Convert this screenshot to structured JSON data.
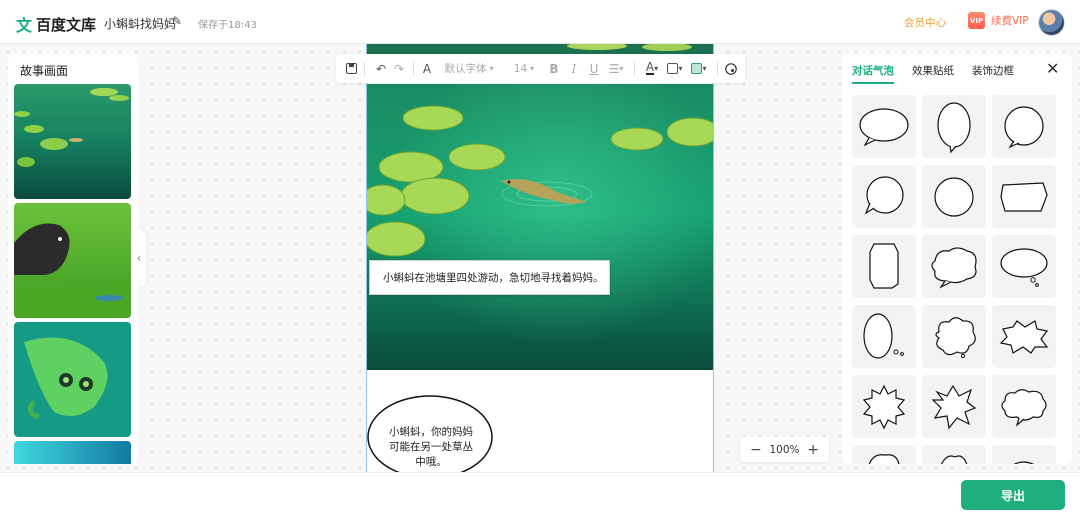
{
  "header": {
    "logo_glyph": "文",
    "logo_text": "百度文库",
    "doc_title": "小蝌蚪找妈妈",
    "save_status": "保存于18:43",
    "member_center": "会员中心",
    "vip_badge": "VIP",
    "vip_label": "续费VIP"
  },
  "left_panel": {
    "title": "故事画面",
    "collapse_glyph": "‹"
  },
  "toolbar": {
    "font_family": "默认字体",
    "font_size": "14",
    "bold": "B",
    "italic": "I",
    "underline": "U",
    "text_glyph": "A",
    "dropdown_glyph": "▾"
  },
  "canvas": {
    "caption": "小蝌蚪在池塘里四处游动，急切地寻找着妈妈。",
    "speech_lines": [
      "小蝌蚪，你的妈妈",
      "可能在另一处草丛",
      "中哦。"
    ]
  },
  "zoom": {
    "minus": "−",
    "value": "100%",
    "plus": "+"
  },
  "right_panel": {
    "tabs": [
      {
        "label": "对话气泡"
      },
      {
        "label": "效果贴纸"
      },
      {
        "label": "装饰边框"
      }
    ],
    "close_glyph": "✕"
  },
  "footer": {
    "export_label": "导出"
  },
  "colors": {
    "accent": "#1fae7f",
    "vip": "#ff6b4a",
    "member": "#e8a23a",
    "pond_dark": "#0a4b3c",
    "pond_light": "#1f9a6d"
  }
}
